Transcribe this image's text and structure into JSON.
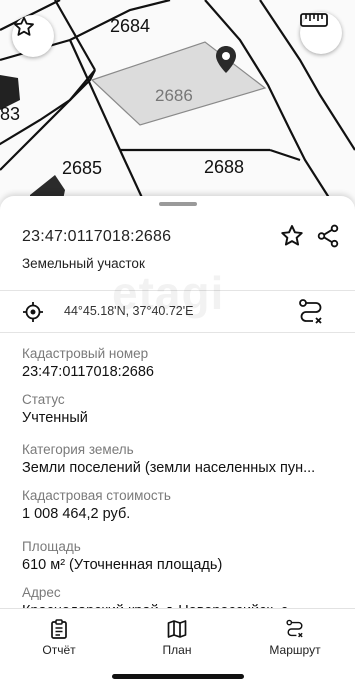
{
  "map": {
    "parcels": [
      "2684",
      "2686",
      "2685",
      "2688",
      "83"
    ]
  },
  "card": {
    "cadastral_title": "23:47:0117018:2686",
    "object_type": "Земельный участок",
    "coordinates": "44°45.18'N, 37°40.72'E",
    "watermark": "etagi"
  },
  "fields": [
    {
      "label": "Кадастровый номер",
      "value": "23:47:0117018:2686"
    },
    {
      "label": "Статус",
      "value": "Учтенный"
    },
    {
      "label": "Категория земель",
      "value": "Земли поселений (земли населенных пун..."
    },
    {
      "label": "Кадастровая стоимость",
      "value": "1 008 464,2 руб."
    },
    {
      "label": "Площадь",
      "value": "610 м² (Уточненная площадь)"
    },
    {
      "label": "Адрес",
      "value": "Краснодарский край, г. Новороссийск, с..."
    }
  ],
  "tabs": {
    "report": "Отчёт",
    "plan": "План",
    "route": "Маршрут"
  },
  "icons": {
    "favorite": "star-icon",
    "ruler": "ruler-icon",
    "share": "share-icon",
    "location": "location-target-icon",
    "route": "route-icon",
    "pin": "map-pin-icon",
    "report": "clipboard-icon",
    "plan": "map-icon",
    "route_tab": "route-icon"
  }
}
